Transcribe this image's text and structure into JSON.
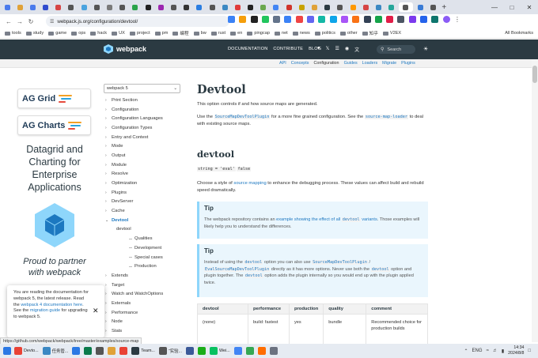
{
  "browser": {
    "url": "webpack.js.org/configuration/devtool/",
    "tabs_favicon_colors": [
      "#4b7bec",
      "#e0a238",
      "#4b7bec",
      "#2f4bce",
      "#d64545",
      "#555",
      "#4aa3df",
      "#555",
      "#7a7a7a",
      "#555",
      "#2aa34a",
      "#222",
      "#9c27b0",
      "#555",
      "#333",
      "#2a7de1",
      "#555",
      "#3b88c3",
      "#e03b3b",
      "#222",
      "#6aa84f",
      "#4285f4",
      "#d0342c",
      "#c7a200",
      "#e0a238",
      "#2b3a42",
      "#555",
      "#ff9800",
      "#d64545",
      "#3b88c3",
      "#26a69a",
      "#555",
      "#3a7bd5",
      "#555"
    ],
    "ext_colors": [
      "#3b82f6",
      "#f59e0b",
      "#222",
      "#22c55e",
      "#64748b",
      "#3b82f6",
      "#ef4444",
      "#6366f1",
      "#14b8a6",
      "#0ea5e9",
      "#a855f7",
      "#f97316",
      "#334155",
      "#16a34a",
      "#e11d48",
      "#4b5563",
      "#7c3aed",
      "#2563eb",
      "#0f766e"
    ],
    "bookmarks": [
      "tools",
      "study",
      "game",
      "ops",
      "hack",
      "UX",
      "project",
      "pm",
      "编程",
      "bw",
      "rust",
      "en",
      "pingcap",
      "net",
      "news",
      "politics",
      "other",
      "知乎",
      "V2EX"
    ],
    "all_bookmarks": "All Bookmarks"
  },
  "header": {
    "logo": "webpack",
    "nav": [
      "DOCUMENTATION",
      "CONTRIBUTE",
      "BLOG"
    ],
    "search_placeholder": "Search",
    "subnav": [
      "API",
      "Concepts",
      "Configuration",
      "Guides",
      "Loaders",
      "Migrate",
      "Plugins"
    ],
    "subnav_current": "Configuration"
  },
  "ads": {
    "ag_grid": "AG Grid",
    "ag_charts": "AG Charts",
    "tagline": "Datagrid and Charting for Enterprise Applications",
    "proud": "Proud to partner with webpack"
  },
  "sidebar": {
    "version": "webpack 5",
    "items": [
      {
        "label": "Print Section",
        "level": 0,
        "chevron": "›"
      },
      {
        "label": "Configuration",
        "level": 0,
        "chevron": "›"
      },
      {
        "label": "Configuration Languages",
        "level": 0,
        "chevron": "›"
      },
      {
        "label": "Configuration Types",
        "level": 0,
        "chevron": "›"
      },
      {
        "label": "Entry and Context",
        "level": 0,
        "chevron": "›"
      },
      {
        "label": "Mode",
        "level": 0,
        "chevron": "›"
      },
      {
        "label": "Output",
        "level": 0,
        "chevron": "›"
      },
      {
        "label": "Module",
        "level": 0,
        "chevron": "›"
      },
      {
        "label": "Resolve",
        "level": 0,
        "chevron": "›"
      },
      {
        "label": "Optimization",
        "level": 0,
        "chevron": "›"
      },
      {
        "label": "Plugins",
        "level": 0,
        "chevron": "›"
      },
      {
        "label": "DevServer",
        "level": 0,
        "chevron": "›"
      },
      {
        "label": "Cache",
        "level": 0,
        "chevron": "›"
      },
      {
        "label": "Devtool",
        "level": 0,
        "chevron": "⌄",
        "active": true
      },
      {
        "label": "devtool",
        "level": 1
      },
      {
        "label": "Qualities",
        "level": 2
      },
      {
        "label": "Development",
        "level": 2
      },
      {
        "label": "Special cases",
        "level": 2
      },
      {
        "label": "Production",
        "level": 2
      },
      {
        "label": "Extends",
        "level": 0,
        "chevron": "›"
      },
      {
        "label": "Target",
        "level": 0,
        "chevron": "›"
      },
      {
        "label": "Watch and WatchOptions",
        "level": 0,
        "chevron": "›"
      },
      {
        "label": "Externals",
        "level": 0,
        "chevron": "›"
      },
      {
        "label": "Performance",
        "level": 0,
        "chevron": "›"
      },
      {
        "label": "Node",
        "level": 0,
        "chevron": "›"
      },
      {
        "label": "Stats",
        "level": 0,
        "chevron": "›"
      }
    ]
  },
  "main": {
    "title": "Devtool",
    "intro": "This option controls if and how source maps are generated.",
    "use_pre": "Use the",
    "use_code1": "SourceMapDevToolPlugin",
    "use_mid": "for a more fine grained configuration. See the",
    "use_code2": "source-map-loader",
    "use_post": "to deal with existing source maps.",
    "h2": "devtool",
    "sig_code1": "string = 'eval'",
    "sig_code2": "false",
    "choose_pre": "Choose a style of",
    "choose_link": "source mapping",
    "choose_post": "to enhance the debugging process. These values can affect build and rebuild speed dramatically.",
    "tip1": {
      "title": "Tip",
      "pre": "The webpack repository contains an",
      "link": "example showing the effect of all",
      "code": "devtool",
      "link2": "variants",
      "post": ". Those examples will likely help you to understand the differences."
    },
    "tip2": {
      "title": "Tip",
      "t1": "Instead of using the",
      "c1": "devtool",
      "t2": "option you can also use",
      "c2": "SourceMapDevToolPlugin",
      "t3": "/",
      "c3": "EvalSourceMapDevToolPlugin",
      "t4": "directly as it has more options. Never use both the",
      "c4": "devtool",
      "t5": "option and plugin together. The",
      "c5": "devtool",
      "t6": "option adds the plugin internally so you would end up with the plugin applied twice."
    },
    "table": {
      "headers": [
        "devtool",
        "performance",
        "production",
        "quality",
        "comment"
      ],
      "row": [
        "(none)",
        "build: fastest",
        "yes",
        "bundle",
        "Recommended choice for production builds"
      ]
    }
  },
  "popup": {
    "t1": "You are reading the documentation for webpack 5, the latest release. Read the",
    "link": "webpack 4 documentation here",
    "t2": ". See the",
    "link2": "migration guide",
    "t3": "for upgrading to webpack 5."
  },
  "status_url": "https://github.com/webpack/webpack/tree/master/examples/source-map",
  "taskbar": {
    "apps": [
      "Devto...",
      "任务管...",
      "",
      "",
      "",
      "",
      "",
      "Team...",
      "“实验...",
      "",
      "",
      "Wei...",
      "",
      "",
      "",
      ""
    ],
    "lang": "ENG",
    "time": "14:34",
    "date": "2024/8/8"
  }
}
